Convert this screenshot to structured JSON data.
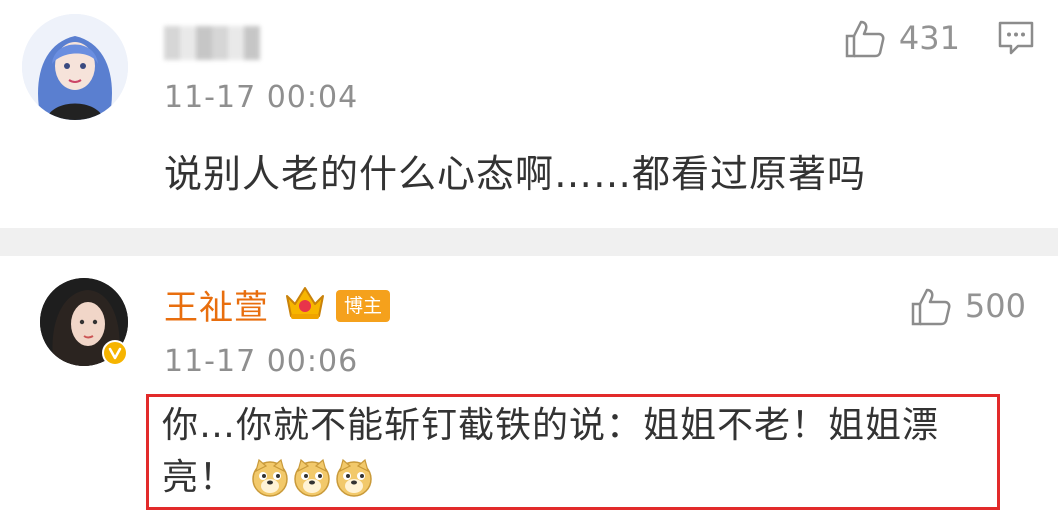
{
  "comments": [
    {
      "avatar_icon": "anime-girl-avatar-icon",
      "author_name_blurred": true,
      "time": "11-17 00:04",
      "likes": "431",
      "text": "说别人老的什么心态啊……都看过原著吗"
    },
    {
      "avatar_icon": "actress-avatar-icon",
      "verified_icon": "verified-v-badge-icon",
      "author_name": "王祉萱",
      "crown_icon": "crown-icon",
      "badge": "博主",
      "time": "11-17 00:06",
      "likes": "500",
      "text": "你…你就不能斩钉截铁的说：姐姐不老！姐姐漂亮！",
      "emojis": [
        "doge-emoji",
        "doge-emoji",
        "doge-emoji"
      ]
    }
  ],
  "colors": {
    "author": "#e86e0e",
    "badge": "#f5a11c",
    "highlight": "#e22a2a",
    "meta": "#8f8f8f",
    "separator": "#f0f0f0"
  }
}
